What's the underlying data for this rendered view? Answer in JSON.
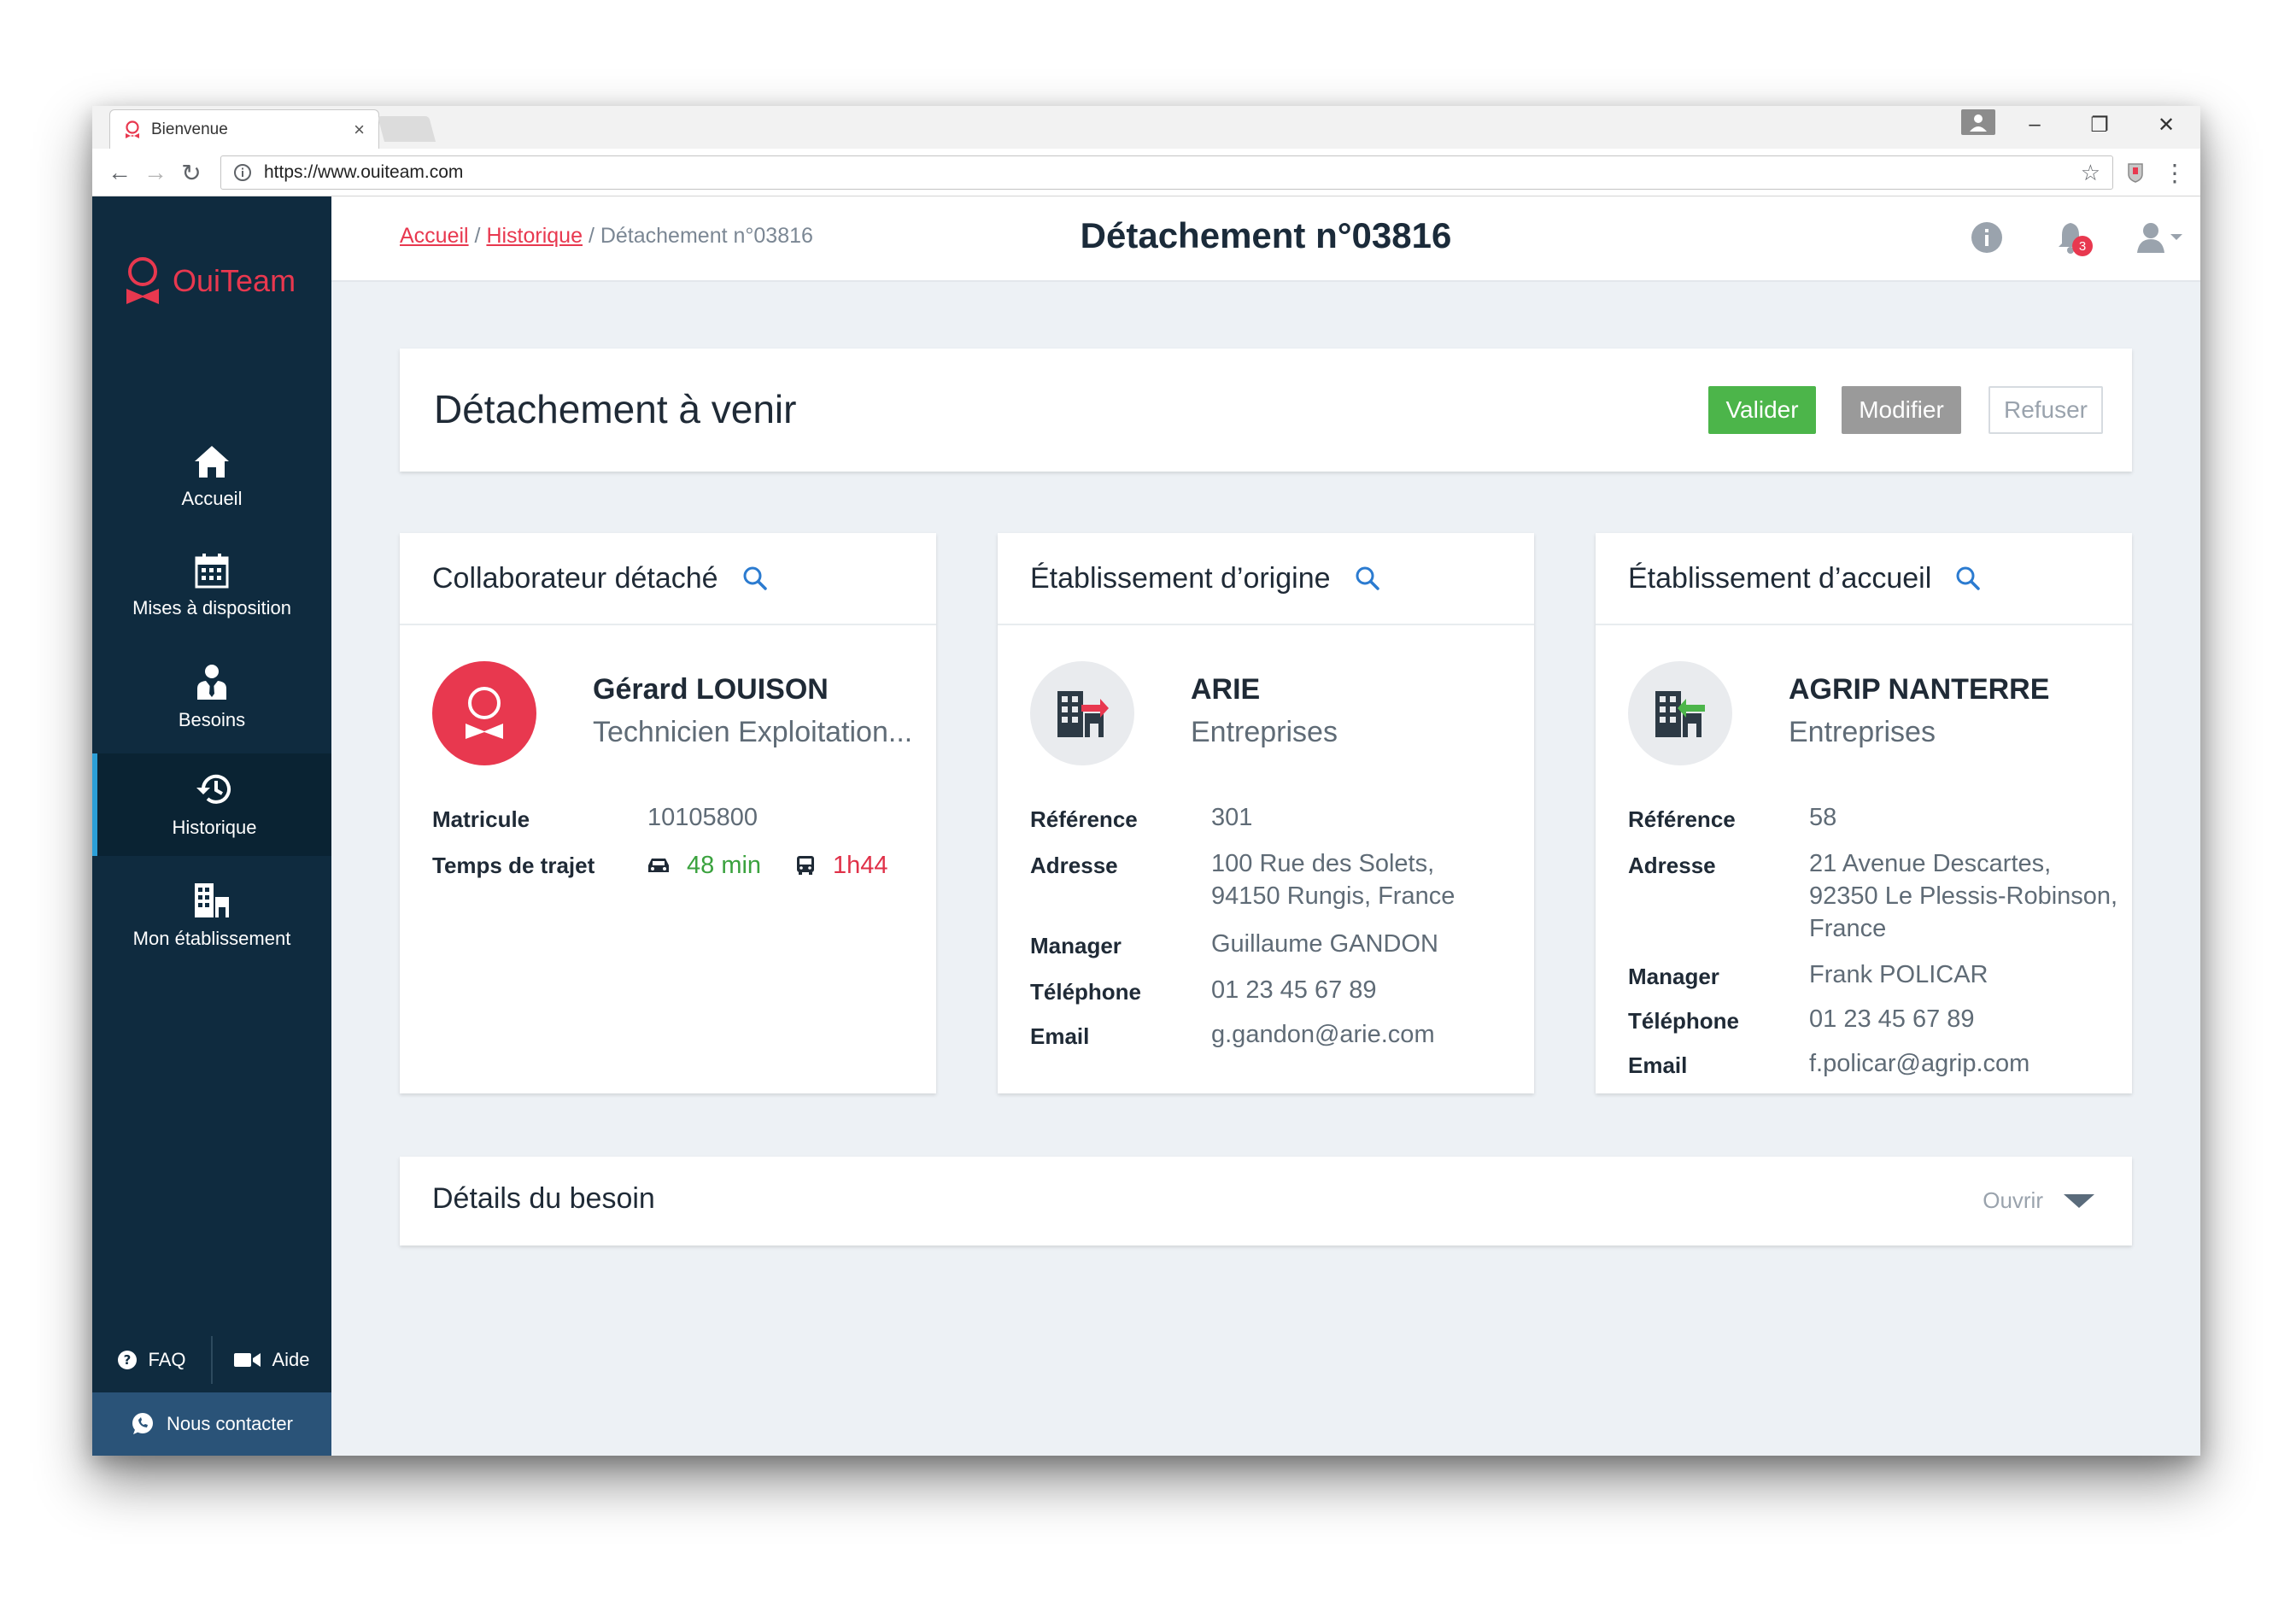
{
  "browser": {
    "tab_title": "Bienvenue",
    "tab_close": "×",
    "url": "https://www.ouiteam.com",
    "minimize": "–",
    "restore": "❐",
    "close": "✕"
  },
  "sidebar": {
    "logo_text": "OuiTeam",
    "items": [
      {
        "label": "Accueil",
        "icon": "home-icon"
      },
      {
        "label": "Mises à disposition",
        "icon": "calendar-icon"
      },
      {
        "label": "Besoins",
        "icon": "person-tie-icon"
      },
      {
        "label": "Historique",
        "icon": "history-icon"
      },
      {
        "label": "Mon établissement",
        "icon": "building-icon"
      }
    ],
    "active_item": "Historique",
    "faq_label": "FAQ",
    "help_label": "Aide",
    "contact_label": "Nous contacter"
  },
  "topbar": {
    "breadcrumb": {
      "home": "Accueil",
      "separator": " / ",
      "history": "Historique",
      "current": "Détachement n°03816"
    },
    "title": "Détachement n°03816",
    "notification_count": "3"
  },
  "header": {
    "title": "Détachement à venir",
    "validate_label": "Valider",
    "modify_label": "Modifier",
    "refuse_label": "Refuser"
  },
  "collaborator": {
    "title": "Collaborateur détaché",
    "name": "Gérard LOUISON",
    "role": "Technicien Exploitation...",
    "matricule_label": "Matricule",
    "matricule": "10105800",
    "travel_label": "Temps de trajet",
    "car_time": "48 min",
    "transit_time": "1h44"
  },
  "origin": {
    "title": "Établissement d’origine",
    "name": "ARIE",
    "type": "Entreprises",
    "reference_label": "Référence",
    "reference": "301",
    "address_label": "Adresse",
    "address_line1": "100 Rue des Solets,",
    "address_line2": "94150 Rungis, France",
    "manager_label": "Manager",
    "manager": "Guillaume GANDON",
    "phone_label": "Téléphone",
    "phone": "01 23 45 67 89",
    "email_label": "Email",
    "email": "g.gandon@arie.com"
  },
  "host": {
    "title": "Établissement d’accueil",
    "name": "AGRIP NANTERRE",
    "type": "Entreprises",
    "reference_label": "Référence",
    "reference": "58",
    "address_label": "Adresse",
    "address_line1": "21 Avenue Descartes,",
    "address_line2": "92350 Le Plessis-Robinson,",
    "address_line3": "France",
    "manager_label": "Manager",
    "manager": "Frank POLICAR",
    "phone_label": "Téléphone",
    "phone": "01 23 45 67 89",
    "email_label": "Email",
    "email": "f.policar@agrip.com"
  },
  "details": {
    "title": "Détails du besoin",
    "open_label": "Ouvrir"
  },
  "colors": {
    "brand": "#e8384f",
    "sidebar": "#0f2b3f",
    "active_accent": "#2b9fd8",
    "valider": "#4cb54a",
    "modifier": "#9a9a9a",
    "search_icon": "#2b7bd0"
  }
}
